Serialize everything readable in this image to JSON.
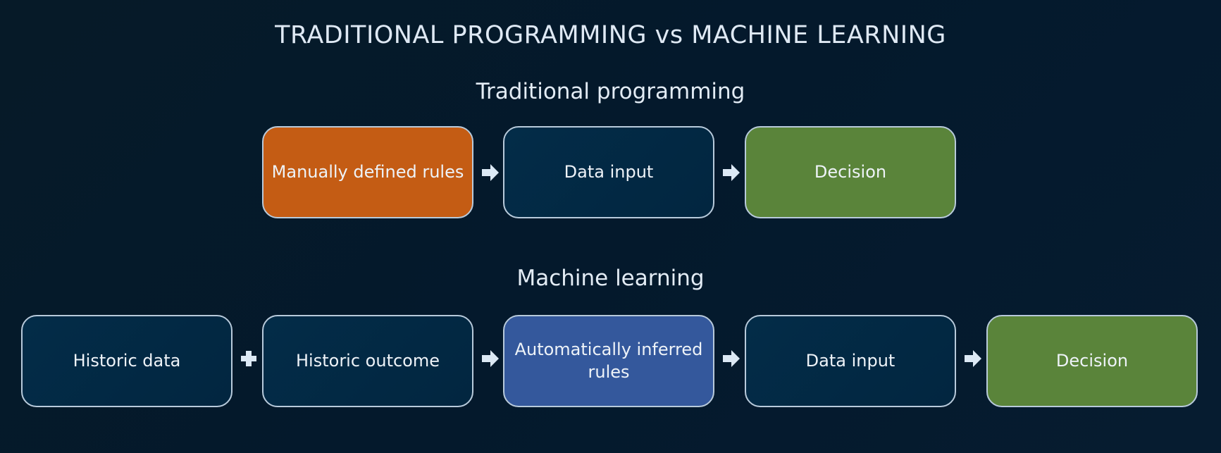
{
  "title": "TRADITIONAL PROGRAMMING vs MACHINE LEARNING",
  "traditional": {
    "heading": "Traditional programming",
    "boxes": [
      "Manually defined rules",
      "Data input",
      "Decision"
    ],
    "connectors": [
      "arrow",
      "arrow"
    ]
  },
  "ml": {
    "heading": "Machine learning",
    "boxes": [
      "Historic data",
      "Historic outcome",
      "Automatically inferred rules",
      "Data input",
      "Decision"
    ],
    "connectors": [
      "plus",
      "arrow",
      "arrow",
      "arrow"
    ]
  },
  "colors": {
    "orange": "#c45c14",
    "green": "#5a843a",
    "blue": "#34589c",
    "dark": "#032c48",
    "border": "#b8cadb"
  }
}
